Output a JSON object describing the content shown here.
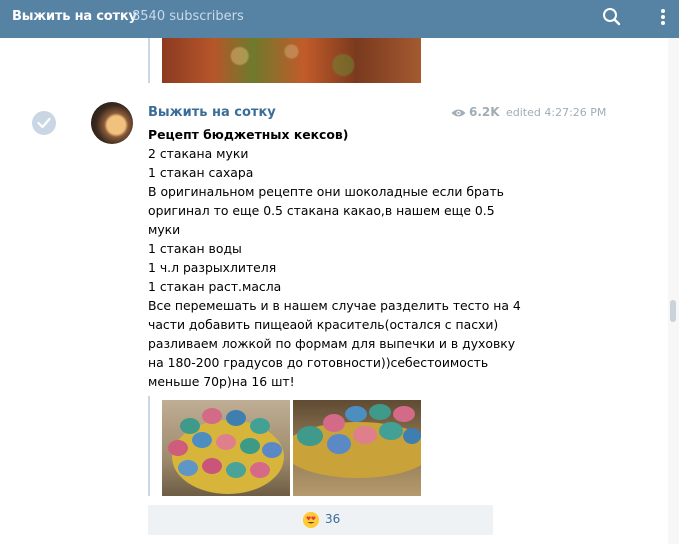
{
  "header": {
    "title": "Выжить на сотку",
    "subscribers": "8540 subscribers"
  },
  "post": {
    "author": "Выжить на сотку",
    "views": "6.2K",
    "edited": "edited 4:27:26 PM",
    "lines": [
      "Рецепт бюджетных кексов)",
      "2 стакана муки",
      "1 стакан сахара",
      "В оригинальном рецепте они шоколадные если брать",
      "оригинал то еще 0.5 стакана какао,в нашем еще 0.5",
      "муки",
      "1 стакан воды",
      "1 ч.л разрыхлителя",
      "1 стакан раст.масла",
      "Все перемешать и в нашем случае разделить тесто на 4",
      "части добавить пищеаой краситель(остался с пасхи)",
      "разливаем ложкой по формам для выпечки и в духовку",
      "на 180-200 градусов до готовности))себестоимость",
      "меньше 70р)на 16 шт!"
    ],
    "reaction": {
      "emoji": "heart-eyes",
      "count": "36"
    }
  },
  "colors": {
    "header_bg": "#5682a3",
    "link": "#3a6d99",
    "meta": "#a0acb6",
    "reaction_bg": "#eef2f5"
  }
}
